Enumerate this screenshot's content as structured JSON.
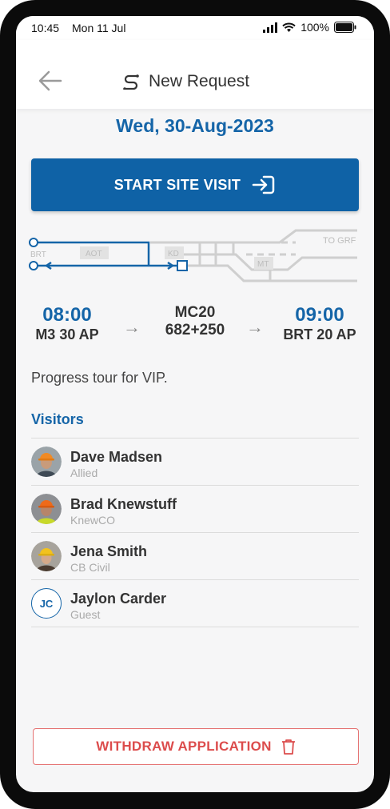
{
  "status": {
    "time": "10:45",
    "date": "Mon 11 Jul",
    "battery": "100%"
  },
  "appbar": {
    "title": "New Request",
    "back_icon": "arrow-left-icon",
    "title_icon": "route-icon"
  },
  "date_heading": "Wed, 30-Aug-2023",
  "start_button": {
    "label": "START SITE VISIT",
    "icon": "enter-icon"
  },
  "route_map": {
    "labels": [
      "BRT",
      "AOT",
      "KD",
      "MT",
      "TO GRF"
    ],
    "accent": "#1565a8"
  },
  "schedule": {
    "start": {
      "time": "08:00",
      "place": "M3 30 AP"
    },
    "via": {
      "line1": "MC20",
      "line2": "682+250"
    },
    "end": {
      "time": "09:00",
      "place": "BRT 20 AP"
    }
  },
  "description": "Progress tour for VIP.",
  "visitors_label": "Visitors",
  "visitors": [
    {
      "name": "Dave Madsen",
      "org": "Allied"
    },
    {
      "name": "Brad Knewstuff",
      "org": "KnewCO"
    },
    {
      "name": "Jena Smith",
      "org": "CB Civil"
    },
    {
      "name": "Jaylon Carder",
      "org": "Guest",
      "initials": "JC"
    }
  ],
  "withdraw_button": {
    "label": "WITHDRAW APPLICATION",
    "icon": "trash-icon"
  },
  "colors": {
    "primary": "#0f62a6",
    "danger": "#dc4c4c"
  }
}
